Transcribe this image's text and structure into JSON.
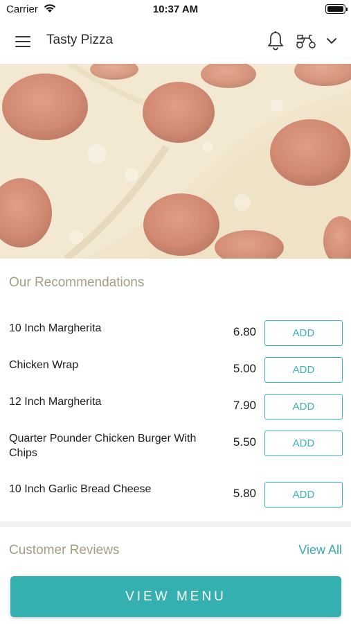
{
  "status_bar": {
    "carrier": "Carrier",
    "time": "10:37 AM",
    "wifi_icon": "wifi-icon",
    "battery_icon": "battery-icon"
  },
  "header": {
    "title": "Tasty Pizza",
    "icons": [
      "hamburger-menu-icon",
      "bell-icon",
      "delivery-scooter-icon",
      "chevron-down-icon"
    ]
  },
  "hero": {
    "image": "pepperoni-pizza-photo"
  },
  "recommendations": {
    "title": "Our Recommendations",
    "add_label": "ADD",
    "items": [
      {
        "name": "10 Inch Margherita",
        "price": "6.80"
      },
      {
        "name": "Chicken Wrap",
        "price": "5.00"
      },
      {
        "name": "12 Inch Margherita",
        "price": "7.90"
      },
      {
        "name": "Quarter Pounder Chicken Burger With Chips",
        "price": "5.50"
      },
      {
        "name": "10 Inch Garlic Bread Cheese",
        "price": "5.80"
      }
    ]
  },
  "reviews": {
    "title": "Customer Reviews",
    "view_all": "View All"
  },
  "footer": {
    "view_menu": "VIEW MENU"
  },
  "colors": {
    "accent": "#34b0b1",
    "section_heading": "#a59e83",
    "link": "#3aa7b3"
  }
}
